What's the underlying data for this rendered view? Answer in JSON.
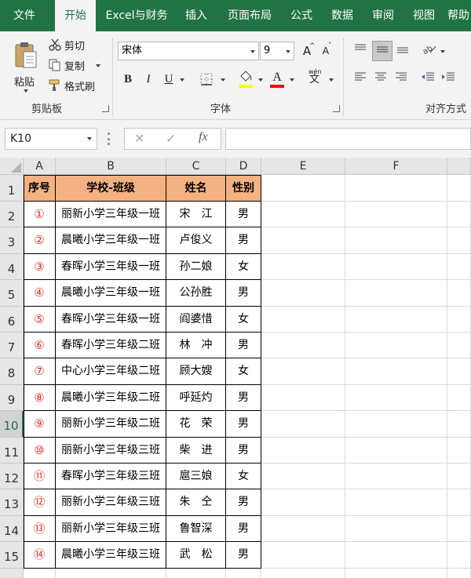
{
  "ribbon": {
    "tabs": [
      "文件",
      "开始",
      "Excel与财务",
      "插入",
      "页面布局",
      "公式",
      "数据",
      "审阅",
      "视图",
      "帮助"
    ],
    "active_tab": "开始",
    "clipboard": {
      "paste": "粘贴",
      "cut": "剪切",
      "copy": "复制",
      "format_painter": "格式刷",
      "label": "剪贴板"
    },
    "font": {
      "name": "宋体",
      "size": "9",
      "label": "字体",
      "bold": "B",
      "italic": "I",
      "underline": "U",
      "grow": "A",
      "shrink": "A",
      "font_color": "A",
      "phonetic": "wén",
      "phonetic_char": "文"
    },
    "alignment": {
      "label": "对齐方式"
    }
  },
  "formula_bar": {
    "name_box": "K10",
    "cancel": "✕",
    "enter": "✓",
    "fx": "fx",
    "value": ""
  },
  "sheet": {
    "columns": [
      "A",
      "B",
      "C",
      "D",
      "E",
      "F"
    ],
    "rows": [
      "1",
      "2",
      "3",
      "4",
      "5",
      "6",
      "7",
      "8",
      "9",
      "10",
      "11",
      "12",
      "13",
      "14",
      "15"
    ],
    "selected_row": "10",
    "header": [
      "序号",
      "学校-班级",
      "姓名",
      "性别"
    ],
    "data": [
      [
        "①",
        "丽新小学三年级一班",
        "宋　江",
        "男"
      ],
      [
        "②",
        "晨曦小学三年级一班",
        "卢俊义",
        "男"
      ],
      [
        "③",
        "春晖小学三年级一班",
        "孙二娘",
        "女"
      ],
      [
        "④",
        "晨曦小学三年级一班",
        "公孙胜",
        "男"
      ],
      [
        "⑤",
        "春晖小学三年级一班",
        "阎婆惜",
        "女"
      ],
      [
        "⑥",
        "春晖小学三年级二班",
        "林　冲",
        "男"
      ],
      [
        "⑦",
        "中心小学三年级二班",
        "顾大嫂",
        "女"
      ],
      [
        "⑧",
        "晨曦小学三年级二班",
        "呼延灼",
        "男"
      ],
      [
        "⑨",
        "丽新小学三年级二班",
        "花　荣",
        "男"
      ],
      [
        "⑩",
        "丽新小学三年级三班",
        "柴　进",
        "男"
      ],
      [
        "⑪",
        "春晖小学三年级三班",
        "扈三娘",
        "女"
      ],
      [
        "⑫",
        "丽新小学三年级三班",
        "朱　仝",
        "男"
      ],
      [
        "⑬",
        "丽新小学三年级三班",
        "鲁智深",
        "男"
      ],
      [
        "⑭",
        "晨曦小学三年级三班",
        "武　松",
        "男"
      ]
    ]
  },
  "colors": {
    "brand": "#217346",
    "header_fill": "#f4b183",
    "index_red": "#e0302a"
  }
}
